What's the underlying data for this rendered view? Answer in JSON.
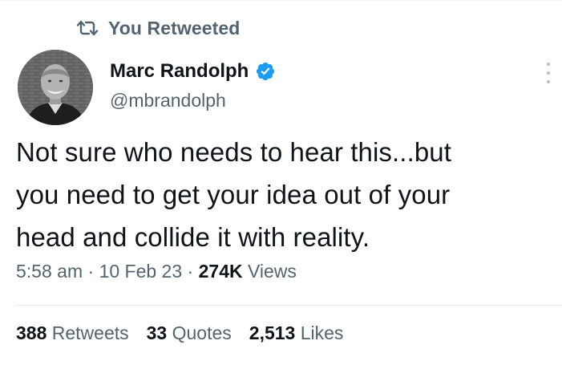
{
  "social_context": {
    "icon": "retweet-icon",
    "label": "You Retweeted"
  },
  "author": {
    "display_name": "Marc Randolph",
    "handle": "@mbrandolph",
    "verified": true,
    "verified_color": "#1d9bf0"
  },
  "tweet": {
    "text_lines": [
      "Not sure who needs to hear this...but",
      "you need to get your idea out of your",
      "head and collide it with reality."
    ]
  },
  "meta": {
    "time": "5:58 am",
    "separator": "·",
    "date": "10 Feb 23",
    "views_count": "274K",
    "views_label": "Views"
  },
  "stats": {
    "retweets_count": "388",
    "retweets_label": "Retweets",
    "quotes_count": "33",
    "quotes_label": "Quotes",
    "likes_count": "2,513",
    "likes_label": "Likes"
  },
  "colors": {
    "primary_text": "#0f1419",
    "secondary_text": "#536471",
    "accent": "#1d9bf0"
  }
}
